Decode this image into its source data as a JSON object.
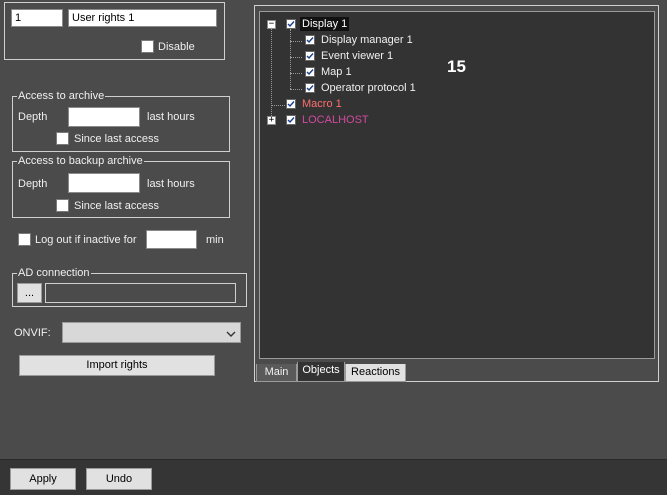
{
  "user": {
    "id": "1",
    "name": "User rights 1",
    "disable_label": "Disable",
    "disable_checked": false
  },
  "archive": {
    "title": "Access to archive",
    "depth_label": "Depth",
    "depth_value": "",
    "hours_label": "last hours",
    "since_label": "Since last access",
    "since_checked": false
  },
  "backup_archive": {
    "title": "Access to backup archive",
    "depth_label": "Depth",
    "depth_value": "",
    "hours_label": "last hours",
    "since_label": "Since last access",
    "since_checked": false
  },
  "logout": {
    "label": "Log out if inactive for",
    "value": "",
    "unit": "min",
    "checked": false
  },
  "ad": {
    "title": "AD connection",
    "browse_label": "...",
    "value": ""
  },
  "onvif": {
    "label": "ONVIF:",
    "selected": "",
    "icon": "chevron-down-icon"
  },
  "import_label": "Import rights",
  "tree": {
    "root": {
      "label": "Display 1",
      "checked": true,
      "expanded": true
    },
    "children": [
      {
        "label": "Display manager 1",
        "checked": true
      },
      {
        "label": "Event viewer 1",
        "checked": true
      },
      {
        "label": "Map 1",
        "checked": true
      },
      {
        "label": "Operator protocol 1",
        "checked": true
      }
    ],
    "macro": {
      "label": "Macro 1",
      "checked": true,
      "color": "#ff6e6e"
    },
    "localhost": {
      "label": "LOCALHOST",
      "checked": true,
      "color": "#d04aa0",
      "expanded": false
    },
    "overlay_number": "15"
  },
  "tabs": [
    {
      "label": "Main",
      "active": false
    },
    {
      "label": "Objects",
      "active": true
    },
    {
      "label": "Reactions",
      "active": false
    }
  ],
  "footer": {
    "apply_label": "Apply",
    "undo_label": "Undo"
  },
  "colors": {
    "background": "#4b4b4b",
    "tree_background": "#333333",
    "footer": "#353535"
  }
}
